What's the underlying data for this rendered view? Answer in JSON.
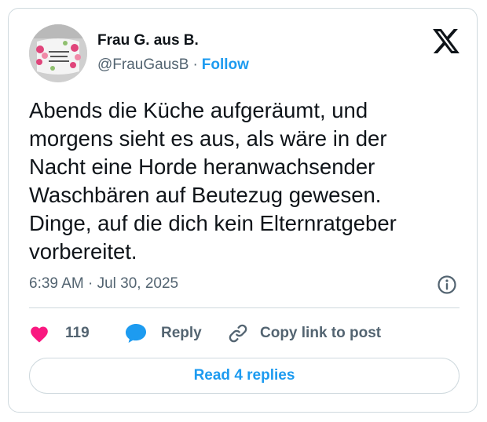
{
  "author": {
    "name": "Frau G. aus B.",
    "handle": "@FrauGausB",
    "separator": "·",
    "follow_label": "Follow",
    "avatar_icon": "profile-avatar-mug-photo"
  },
  "logo": {
    "icon": "x-logo-icon"
  },
  "tweet": {
    "text": "Abends die Küche aufgeräumt, und\nmorgens sieht es aus, als wäre in der\nNacht eine Horde heranwachsender\nWaschbären auf Beutezug gewesen.\nDinge, auf die dich kein Elternratgeber\nvorbereitet.",
    "timestamp": "6:39 AM · Jul 30, 2025"
  },
  "actions": {
    "like": {
      "icon": "heart-icon",
      "count": "119",
      "color": "#f91880"
    },
    "reply": {
      "icon": "speech-bubble-icon",
      "label": "Reply",
      "color": "#1d9bf0"
    },
    "copy": {
      "icon": "link-icon",
      "label": "Copy link to post"
    }
  },
  "info": {
    "icon": "info-icon"
  },
  "read_replies": {
    "label": "Read 4 replies"
  },
  "colors": {
    "accent": "#1d9bf0",
    "like": "#f91880",
    "secondary_text": "#536471",
    "border": "#cfd9de",
    "primary_text": "#0f1419"
  }
}
